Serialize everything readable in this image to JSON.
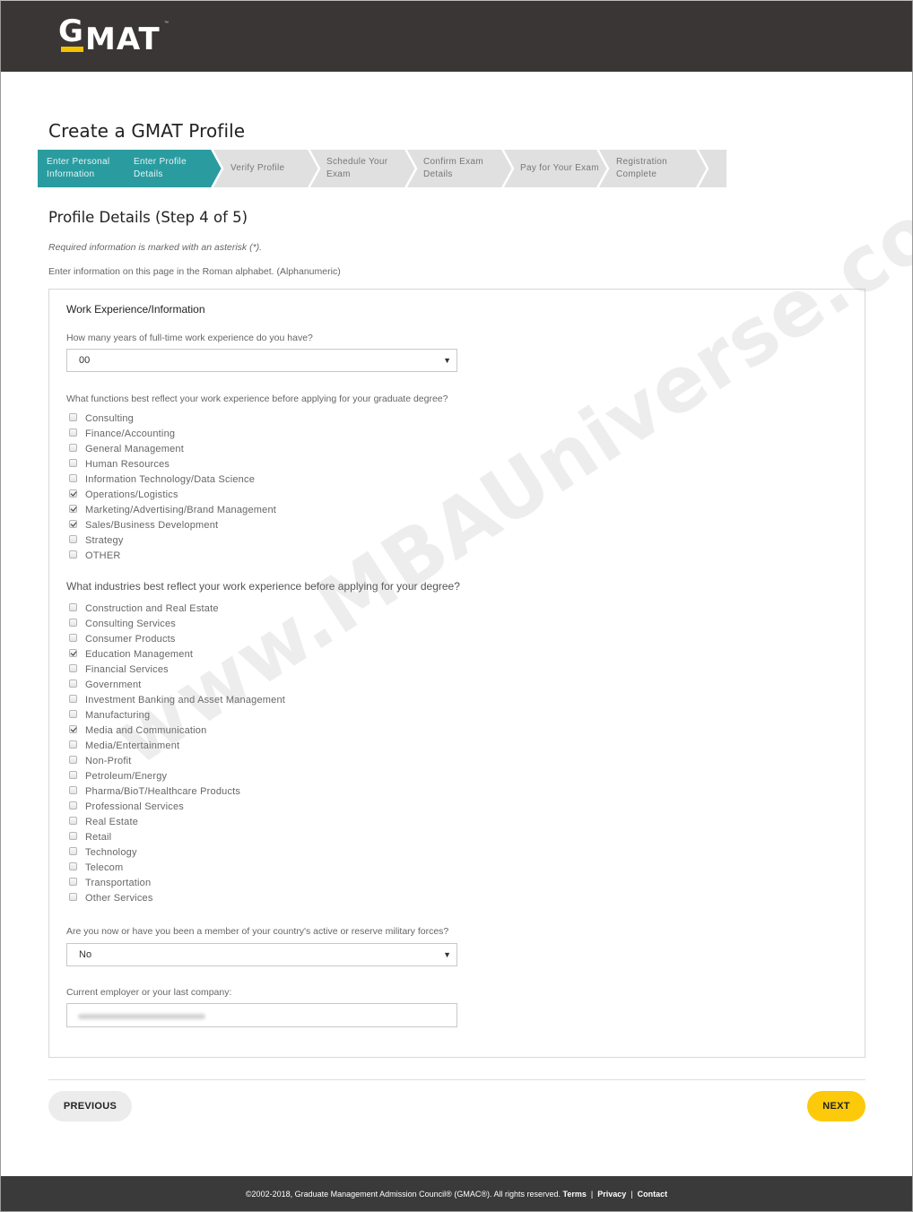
{
  "brand": {
    "logo_g": "G",
    "logo_mat": "MAT",
    "logo_tm": "™",
    "accent_color": "#f2c200",
    "header_color": "#3b3636",
    "stepper_active_color": "#2a9ca0"
  },
  "page_title": "Create a GMAT Profile",
  "stepper": {
    "steps": [
      {
        "label": "Enter Personal Information",
        "line1": "Enter Personal",
        "line2": "Information",
        "state": "completed"
      },
      {
        "label": "Enter Profile Details",
        "line1": "Enter Profile",
        "line2": "Details",
        "state": "current"
      },
      {
        "label": "Verify Profile",
        "line1": "Verify Profile",
        "line2": "",
        "state": "upcoming"
      },
      {
        "label": "Schedule Your Exam",
        "line1": "Schedule Your",
        "line2": "Exam",
        "state": "upcoming"
      },
      {
        "label": "Confirm Exam Details",
        "line1": "Confirm Exam",
        "line2": "Details",
        "state": "upcoming"
      },
      {
        "label": "Pay for Your Exam",
        "line1": "Pay for Your Exam",
        "line2": "",
        "state": "upcoming"
      },
      {
        "label": "Registration Complete",
        "line1": "Registration",
        "line2": "Complete",
        "state": "upcoming"
      }
    ]
  },
  "section": {
    "title": "Profile Details (Step 4 of 5)",
    "required_note": "Required information is marked with an asterisk (*).",
    "alphabet_note": "Enter information on this page in the Roman alphabet. (Alphanumeric)"
  },
  "form": {
    "panel_title": "Work Experience/Information",
    "years_question": "How many years of full-time work experience do you have?",
    "years_value": "00",
    "functions_question": "What functions best reflect your work experience before applying for your graduate degree?",
    "functions": [
      {
        "label": "Consulting",
        "checked": false
      },
      {
        "label": "Finance/Accounting",
        "checked": false
      },
      {
        "label": "General Management",
        "checked": false
      },
      {
        "label": "Human Resources",
        "checked": false
      },
      {
        "label": "Information Technology/Data Science",
        "checked": false
      },
      {
        "label": "Operations/Logistics",
        "checked": true
      },
      {
        "label": "Marketing/Advertising/Brand Management",
        "checked": true
      },
      {
        "label": "Sales/Business Development",
        "checked": true
      },
      {
        "label": "Strategy",
        "checked": false
      },
      {
        "label": "OTHER",
        "checked": false
      }
    ],
    "industries_question": "What industries best reflect your work experience before applying for your degree?",
    "industries": [
      {
        "label": "Construction and Real Estate",
        "checked": false
      },
      {
        "label": "Consulting Services",
        "checked": false
      },
      {
        "label": "Consumer Products",
        "checked": false
      },
      {
        "label": "Education Management",
        "checked": true
      },
      {
        "label": "Financial Services",
        "checked": false
      },
      {
        "label": "Government",
        "checked": false
      },
      {
        "label": "Investment Banking and Asset Management",
        "checked": false
      },
      {
        "label": "Manufacturing",
        "checked": false
      },
      {
        "label": "Media and Communication",
        "checked": true
      },
      {
        "label": "Media/Entertainment",
        "checked": false
      },
      {
        "label": "Non-Profit",
        "checked": false
      },
      {
        "label": "Petroleum/Energy",
        "checked": false
      },
      {
        "label": "Pharma/BioT/Healthcare Products",
        "checked": false
      },
      {
        "label": "Professional Services",
        "checked": false
      },
      {
        "label": "Real Estate",
        "checked": false
      },
      {
        "label": "Retail",
        "checked": false
      },
      {
        "label": "Technology",
        "checked": false
      },
      {
        "label": "Telecom",
        "checked": false
      },
      {
        "label": "Transportation",
        "checked": false
      },
      {
        "label": "Other Services",
        "checked": false
      }
    ],
    "military_question": "Are you now or have you been a member of your country's active or reserve military forces?",
    "military_value": "No",
    "employer_label": "Current employer or your last company:",
    "employer_value_blurred": true
  },
  "buttons": {
    "previous": "PREVIOUS",
    "next": "NEXT"
  },
  "footer": {
    "copyright": "©2002-2018, Graduate Management Admission Council® (GMAC®). All rights reserved.",
    "links": [
      "Terms",
      "Privacy",
      "Contact"
    ],
    "separator": "|"
  },
  "watermark": "www.MBAUniverse.com"
}
